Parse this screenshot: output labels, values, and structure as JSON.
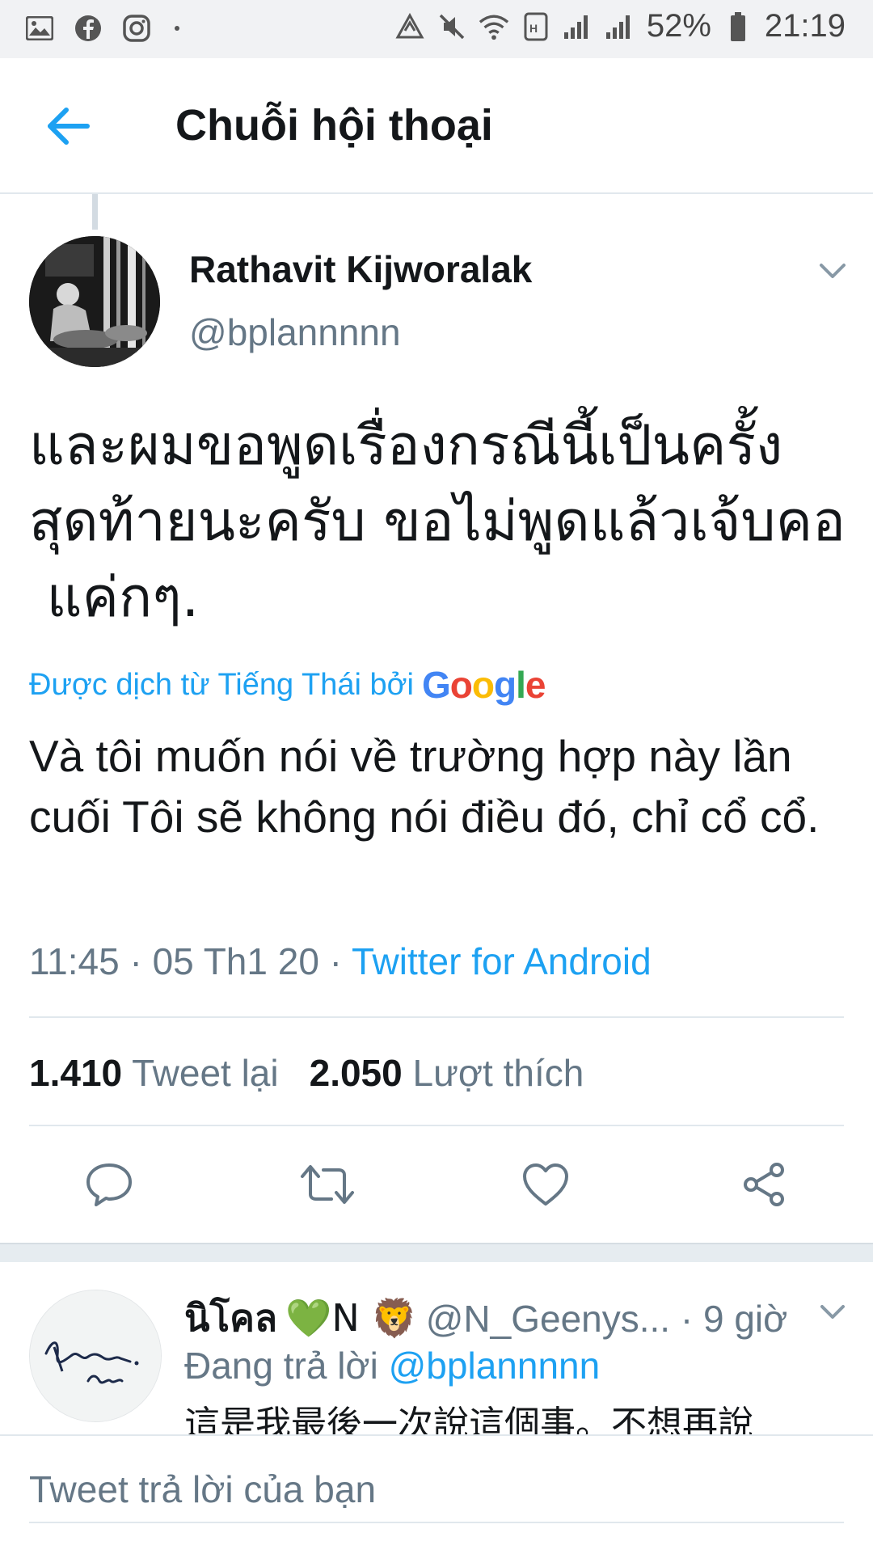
{
  "status_bar": {
    "battery": "52%",
    "time": "21:19",
    "left_icons": [
      "gallery-icon",
      "facebook-icon",
      "instagram-icon"
    ],
    "right_icons": [
      "data-saver-icon",
      "mute-icon",
      "wifi-icon",
      "hd-call-icon",
      "signal-icon",
      "signal-icon",
      "battery-icon"
    ]
  },
  "header": {
    "title": "Chuỗi hội thoại"
  },
  "tweet": {
    "author_name": "Rathavit Kijworalak",
    "author_handle": "@bplannnnn",
    "text": "และผมขอพูดเรื่องกรณีนี้เป็นครั้ง\nสุดท้ายนะครับ ขอไม่พูดแล้วเจ้บคอ\n แค่กๆ.",
    "translated_by": "Được dịch từ Tiếng Thái bởi",
    "translation": "Và tôi muốn nói về trường hợp này lần cuối Tôi sẽ không nói điều đó, chỉ cổ cổ.",
    "time": "11:45 · 05 Th1 20 · ",
    "source": "Twitter for Android",
    "retweets_count": "1.410",
    "retweets_label": "Tweet lại",
    "likes_count": "2.050",
    "likes_label": "Lượt thích"
  },
  "google_logo": {
    "letters": [
      "G",
      "o",
      "o",
      "g",
      "l",
      "e"
    ],
    "colors": [
      "#4285F4",
      "#EA4335",
      "#FBBC05",
      "#4285F4",
      "#34A853",
      "#EA4335"
    ]
  },
  "reply": {
    "name": "นิโคล",
    "name_suffix": "💚N 🦁",
    "handle_time": "@N_Geenys... · 9 giờ",
    "replying_prefix": "Đang trả lời",
    "replying_mention": "@bplannnnn",
    "text": "這是我最後一次說這個事。不想再說"
  },
  "compose": {
    "placeholder": "Tweet trả lời của bạn"
  },
  "colors": {
    "accent": "#1da1f2",
    "text": "#14171a",
    "secondary": "#657786",
    "divider": "#e1e8ed"
  }
}
